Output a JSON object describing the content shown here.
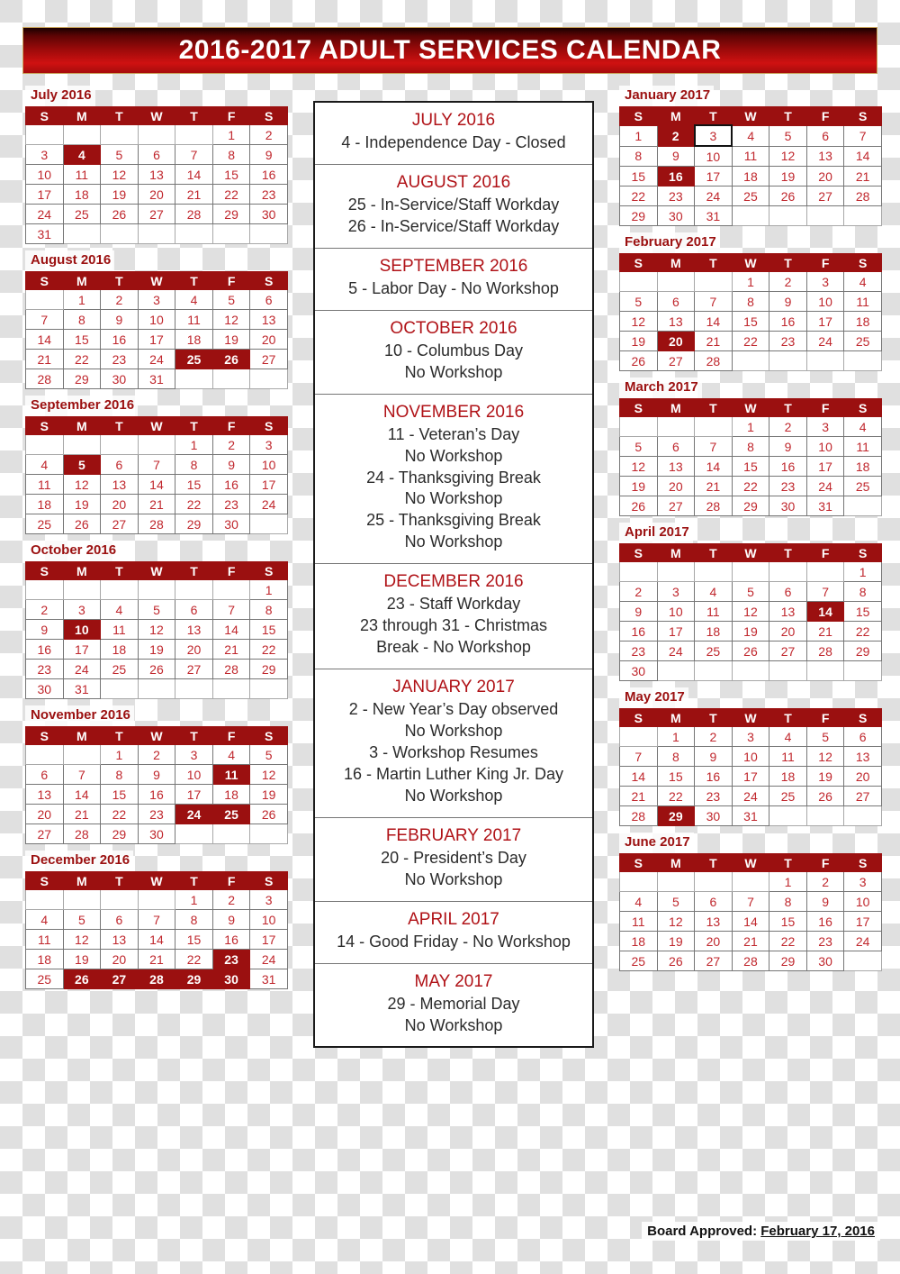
{
  "banner": {
    "title": "2016-2017 ADULT SERVICES CALENDAR"
  },
  "colors": {
    "header_red": "#9B1010",
    "day_number_red": "#C0272D",
    "note_title_red": "#B01217",
    "banner_border_gold": "#C8A35A"
  },
  "weekday_headers": [
    "S",
    "M",
    "T",
    "W",
    "T",
    "F",
    "S"
  ],
  "left_column_months": [
    {
      "label": "July 2016",
      "lead_blanks": 5,
      "days": 31,
      "highlighted": [
        4
      ],
      "outlined": []
    },
    {
      "label": "August 2016",
      "lead_blanks": 1,
      "days": 31,
      "highlighted": [
        25,
        26
      ],
      "outlined": []
    },
    {
      "label": "September 2016",
      "lead_blanks": 4,
      "days": 30,
      "highlighted": [
        5
      ],
      "outlined": []
    },
    {
      "label": "October 2016",
      "lead_blanks": 6,
      "days": 31,
      "highlighted": [
        10
      ],
      "outlined": []
    },
    {
      "label": "November 2016",
      "lead_blanks": 2,
      "days": 30,
      "highlighted": [
        11,
        24,
        25
      ],
      "outlined": []
    },
    {
      "label": "December 2016",
      "lead_blanks": 4,
      "days": 31,
      "highlighted": [
        23,
        26,
        27,
        28,
        29,
        30
      ],
      "outlined": []
    }
  ],
  "right_column_months": [
    {
      "label": "January 2017",
      "lead_blanks": 0,
      "days": 31,
      "highlighted": [
        2,
        16
      ],
      "outlined": [
        3
      ]
    },
    {
      "label": "February 2017",
      "lead_blanks": 3,
      "days": 28,
      "highlighted": [
        20
      ],
      "outlined": []
    },
    {
      "label": "March 2017",
      "lead_blanks": 3,
      "days": 31,
      "highlighted": [],
      "outlined": []
    },
    {
      "label": "April 2017",
      "lead_blanks": 6,
      "days": 30,
      "highlighted": [
        14
      ],
      "outlined": []
    },
    {
      "label": "May 2017",
      "lead_blanks": 1,
      "days": 31,
      "highlighted": [
        29
      ],
      "outlined": []
    },
    {
      "label": "June 2017",
      "lead_blanks": 4,
      "days": 30,
      "highlighted": [],
      "outlined": []
    }
  ],
  "notes": [
    {
      "title": "JULY 2016",
      "lines": [
        "4 - Independence Day - Closed"
      ]
    },
    {
      "title": "AUGUST 2016",
      "lines": [
        "25 - In-Service/Staff Workday",
        "26 - In-Service/Staff Workday"
      ]
    },
    {
      "title": "SEPTEMBER 2016",
      "lines": [
        "5 - Labor Day - No Workshop"
      ]
    },
    {
      "title": "OCTOBER 2016",
      "lines": [
        "10 - Columbus Day",
        "No Workshop"
      ]
    },
    {
      "title": "NOVEMBER 2016",
      "lines": [
        "11 - Veteran’s Day",
        "No Workshop",
        "24 - Thanksgiving Break",
        "No Workshop",
        "25 - Thanksgiving Break",
        "No Workshop"
      ]
    },
    {
      "title": "DECEMBER 2016",
      "lines": [
        "23 - Staff Workday",
        "23 through 31 - Christmas",
        "Break - No Workshop"
      ]
    },
    {
      "title": "JANUARY 2017",
      "lines": [
        "2 - New Year’s Day observed",
        "No Workshop",
        "3 - Workshop Resumes",
        "16 - Martin Luther King Jr. Day",
        "No Workshop"
      ]
    },
    {
      "title": "FEBRUARY 2017",
      "lines": [
        "20 - President’s Day",
        "No Workshop"
      ]
    },
    {
      "title": "APRIL 2017",
      "lines": [
        "14 - Good Friday - No Workshop"
      ]
    },
    {
      "title": "MAY 2017",
      "lines": [
        "29 - Memorial Day",
        "No Workshop"
      ]
    }
  ],
  "footer": {
    "label": "Board Approved:",
    "date": "February 17, 2016"
  }
}
